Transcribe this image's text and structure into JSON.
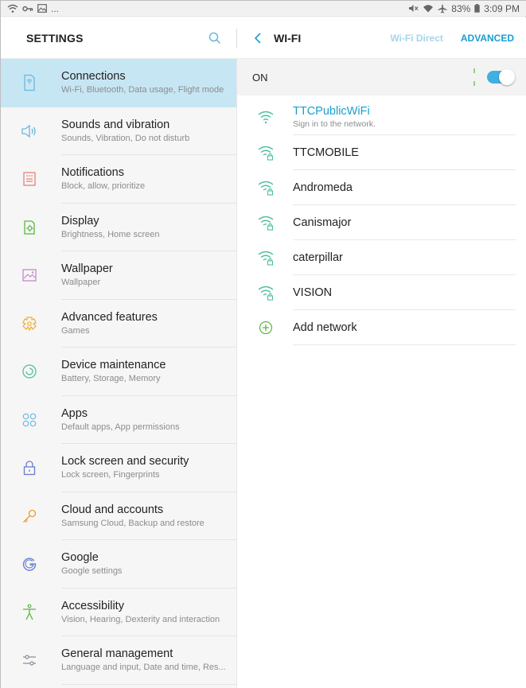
{
  "status_bar": {
    "left_extra": "...",
    "battery": "83%",
    "time": "3:09 PM"
  },
  "header": {
    "title": "SETTINGS",
    "wifi_title": "WI-FI",
    "wifi_direct": "Wi-Fi Direct",
    "advanced": "ADVANCED"
  },
  "sidebar": {
    "items": [
      {
        "title": "Connections",
        "subtitle": "Wi-Fi, Bluetooth, Data usage, Flight mode",
        "icon": "connections-icon"
      },
      {
        "title": "Sounds and vibration",
        "subtitle": "Sounds, Vibration, Do not disturb",
        "icon": "sound-icon"
      },
      {
        "title": "Notifications",
        "subtitle": "Block, allow, prioritize",
        "icon": "notifications-icon"
      },
      {
        "title": "Display",
        "subtitle": "Brightness, Home screen",
        "icon": "display-icon"
      },
      {
        "title": "Wallpaper",
        "subtitle": "Wallpaper",
        "icon": "wallpaper-icon"
      },
      {
        "title": "Advanced features",
        "subtitle": "Games",
        "icon": "advanced-features-icon"
      },
      {
        "title": "Device maintenance",
        "subtitle": "Battery, Storage, Memory",
        "icon": "device-maintenance-icon"
      },
      {
        "title": "Apps",
        "subtitle": "Default apps, App permissions",
        "icon": "apps-icon"
      },
      {
        "title": "Lock screen and security",
        "subtitle": "Lock screen, Fingerprints",
        "icon": "lock-icon"
      },
      {
        "title": "Cloud and accounts",
        "subtitle": "Samsung Cloud, Backup and restore",
        "icon": "key-icon"
      },
      {
        "title": "Google",
        "subtitle": "Google settings",
        "icon": "google-icon"
      },
      {
        "title": "Accessibility",
        "subtitle": "Vision, Hearing, Dexterity and interaction",
        "icon": "accessibility-icon"
      },
      {
        "title": "General management",
        "subtitle": "Language and input, Date and time, Res...",
        "icon": "general-management-icon"
      }
    ]
  },
  "wifi": {
    "on_label": "ON",
    "networks": [
      {
        "name": "TTCPublicWiFi",
        "status": "Sign in to the network."
      },
      {
        "name": "TTCMOBILE"
      },
      {
        "name": "Andromeda"
      },
      {
        "name": "Canismajor"
      },
      {
        "name": "caterpillar"
      },
      {
        "name": "VISION"
      }
    ],
    "add_network": "Add network"
  },
  "colors": {
    "accent": "#1a9dd0",
    "selected_bg": "#c7e6f4",
    "icon_blue": "#6ab8de",
    "icon_green": "#59b83e"
  }
}
